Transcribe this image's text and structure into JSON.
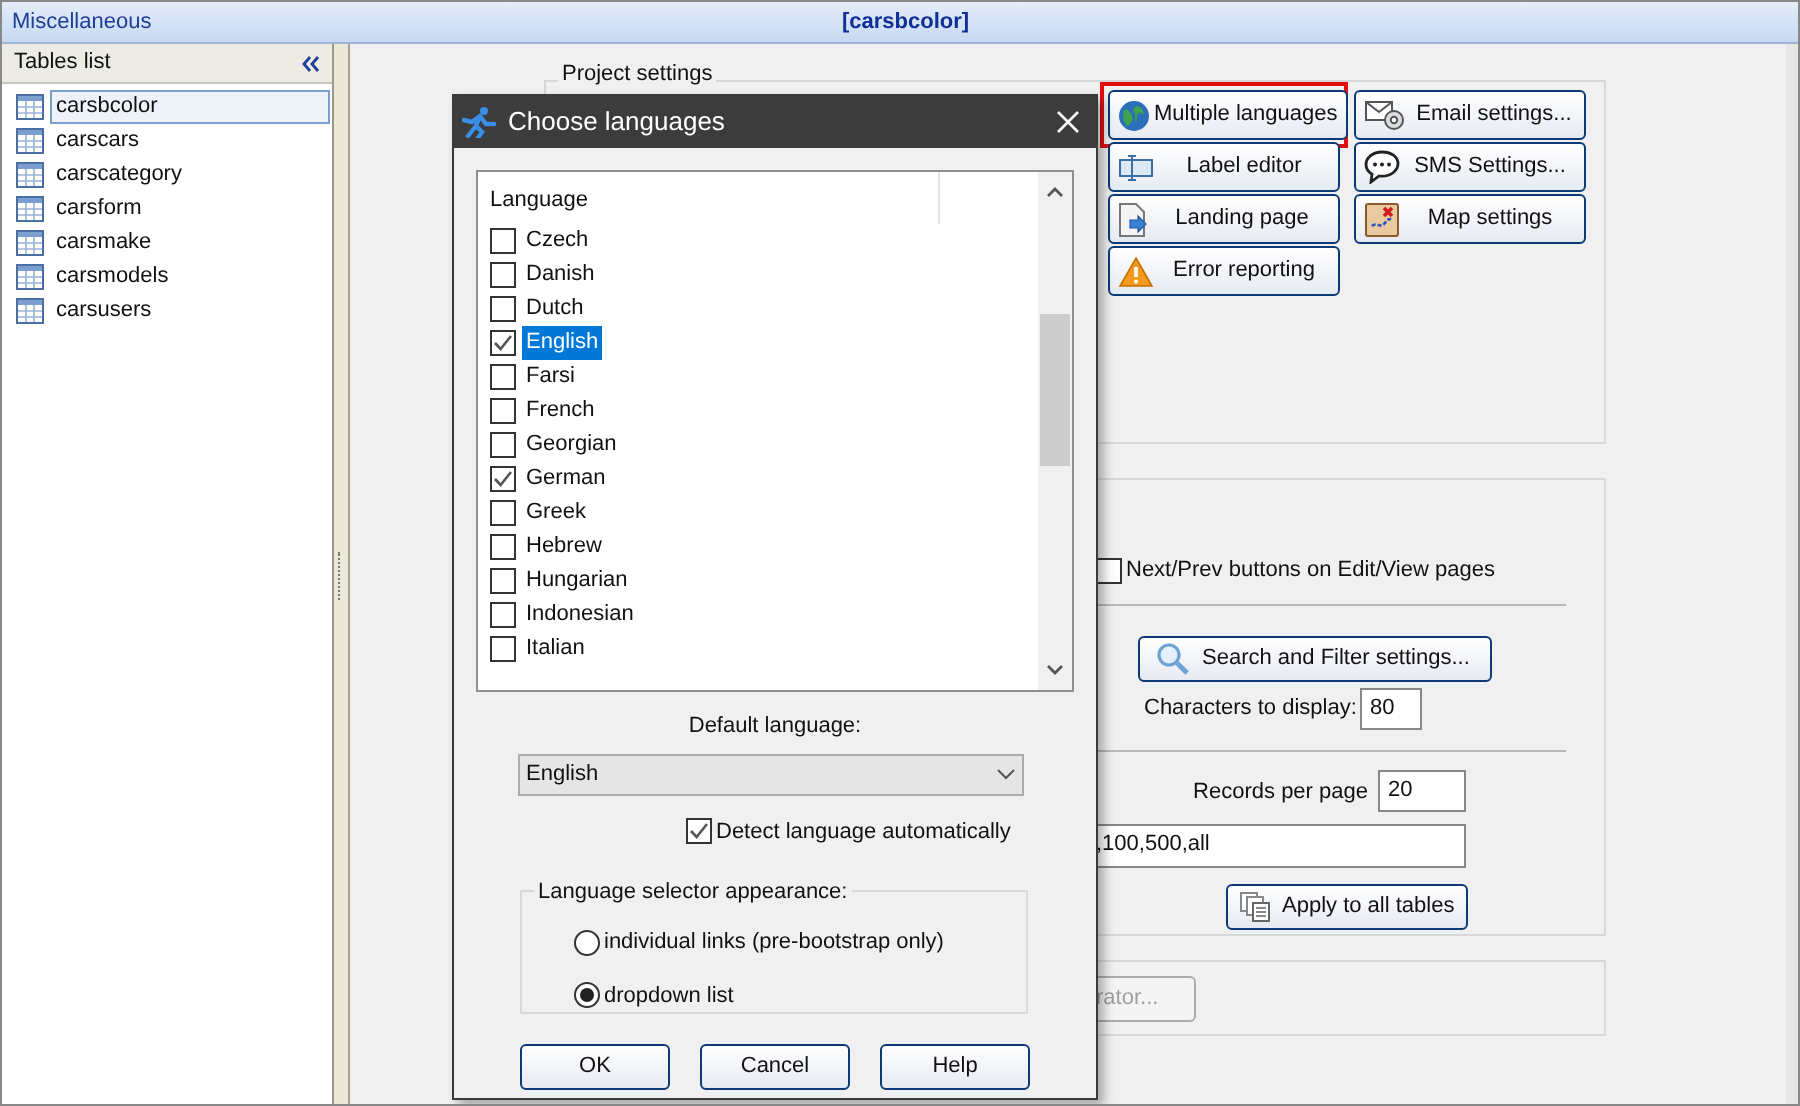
{
  "header": {
    "section": "Miscellaneous",
    "title": "[carsbcolor]"
  },
  "tables_list": {
    "title": "Tables list",
    "items": [
      {
        "name": "carsbcolor",
        "selected": true
      },
      {
        "name": "carscars",
        "selected": false
      },
      {
        "name": "carscategory",
        "selected": false
      },
      {
        "name": "carsform",
        "selected": false
      },
      {
        "name": "carsmake",
        "selected": false
      },
      {
        "name": "carsmodels",
        "selected": false
      },
      {
        "name": "carsusers",
        "selected": false
      }
    ]
  },
  "project_settings": {
    "title": "Project settings",
    "buttons": [
      {
        "label": "Multiple languages",
        "highlighted": true
      },
      {
        "label": "Email settings...",
        "highlighted": false
      },
      {
        "label": "Label editor",
        "highlighted": false
      },
      {
        "label": "SMS Settings...",
        "highlighted": false
      },
      {
        "label": "Landing page",
        "highlighted": false
      },
      {
        "label": "Map settings",
        "highlighted": false
      },
      {
        "label": "Error reporting",
        "highlighted": false
      }
    ]
  },
  "list_settings": {
    "next_prev": {
      "label": "Next/Prev buttons on Edit/View pages",
      "checked": false
    },
    "search_button": "Search and Filter settings...",
    "characters_label": "Characters to display:",
    "characters_value": "80",
    "records_label": "Records per page",
    "records_value": "20",
    "page_sizes_value": ",100,500,all",
    "apply_button": "Apply to all tables"
  },
  "other_settings": {
    "button": "rator...",
    "disabled": true
  },
  "dialog": {
    "title": "Choose languages",
    "column": "Language",
    "languages": [
      {
        "name": "Czech",
        "checked": false,
        "selected": false
      },
      {
        "name": "Danish",
        "checked": false,
        "selected": false
      },
      {
        "name": "Dutch",
        "checked": false,
        "selected": false
      },
      {
        "name": "English",
        "checked": true,
        "selected": true
      },
      {
        "name": "Farsi",
        "checked": false,
        "selected": false
      },
      {
        "name": "French",
        "checked": false,
        "selected": false
      },
      {
        "name": "Georgian",
        "checked": false,
        "selected": false
      },
      {
        "name": "German",
        "checked": true,
        "selected": false
      },
      {
        "name": "Greek",
        "checked": false,
        "selected": false
      },
      {
        "name": "Hebrew",
        "checked": false,
        "selected": false
      },
      {
        "name": "Hungarian",
        "checked": false,
        "selected": false
      },
      {
        "name": "Indonesian",
        "checked": false,
        "selected": false
      },
      {
        "name": "Italian",
        "checked": false,
        "selected": false
      }
    ],
    "default_label": "Default language:",
    "default_value": "English",
    "detect": {
      "label": "Detect language automatically",
      "checked": true
    },
    "selector_title": "Language selector appearance:",
    "selector_options": [
      {
        "label": "individual links (pre-bootstrap only)",
        "selected": false
      },
      {
        "label": "dropdown list",
        "selected": true
      }
    ],
    "buttons": [
      "OK",
      "Cancel",
      "Help"
    ]
  }
}
